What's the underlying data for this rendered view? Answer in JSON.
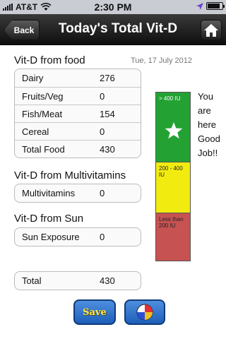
{
  "status_bar": {
    "carrier": "AT&T",
    "time": "2:30 PM"
  },
  "nav": {
    "back_label": "Back",
    "title": "Today's Total Vit-D"
  },
  "food": {
    "title": "Vit-D from food",
    "date": "Tue, 17 July 2012",
    "rows": [
      {
        "label": "Dairy",
        "value": "276"
      },
      {
        "label": "Fruits/Veg",
        "value": "0"
      },
      {
        "label": "Fish/Meat",
        "value": "154"
      },
      {
        "label": "Cereal",
        "value": "0"
      },
      {
        "label": "Total Food",
        "value": "430"
      }
    ]
  },
  "multivitamins": {
    "title": "Vit-D from Multivitamins",
    "rows": [
      {
        "label": "Multivitamins",
        "value": "0"
      }
    ]
  },
  "sun": {
    "title": "Vit-D from Sun",
    "rows": [
      {
        "label": "Sun Exposure",
        "value": "0"
      }
    ]
  },
  "total": {
    "label": "Total",
    "value": "430"
  },
  "scale": {
    "high": "> 400 IU",
    "mid": "200 - 400 IU",
    "low": "Less than 200 IU",
    "colors": {
      "high": "#23a233",
      "mid": "#f2eb10",
      "low": "#c75252"
    },
    "indicator_icon": "star-icon"
  },
  "message": "You are here Good Job!!",
  "buttons": {
    "save_label": "Save",
    "chart_icon": "pie-chart-icon"
  }
}
